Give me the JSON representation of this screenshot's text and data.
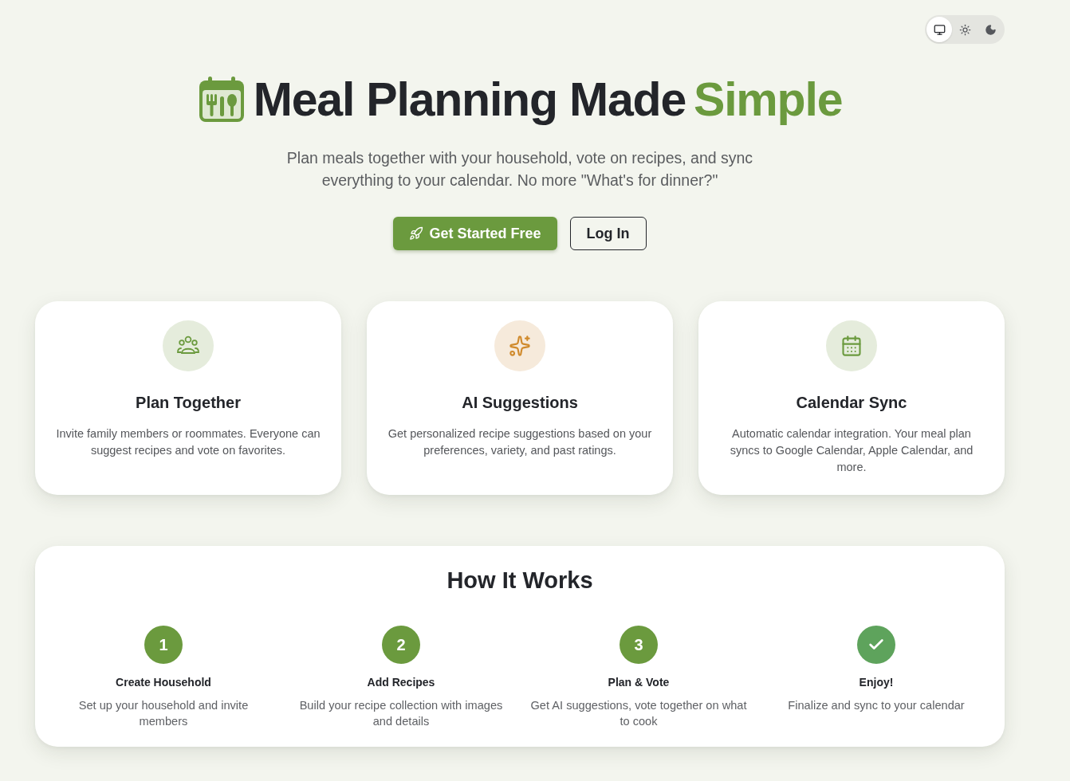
{
  "theme_toggle": [
    {
      "kind": "system",
      "selected": true
    },
    {
      "kind": "light",
      "selected": false
    },
    {
      "kind": "dark",
      "selected": false
    }
  ],
  "hero": {
    "title": "Meal Planning Made",
    "title_highlight": "Simple",
    "subtitle": "Plan meals together with your household, vote on recipes, and sync everything to your calendar. No more \"What's for dinner?\"",
    "buttons": [
      {
        "kind": "primary",
        "label": "Get Started Free"
      },
      {
        "kind": "secondary",
        "label": "Log In"
      }
    ]
  },
  "features": [
    {
      "kind": "people",
      "title": "Plan Together",
      "description": "Invite family members or roommates. Everyone can suggest recipes and vote on favorites."
    },
    {
      "kind": "sparkles",
      "title": "AI Suggestions",
      "description": "Get personalized recipe suggestions based on your preferences, variety, and past ratings."
    },
    {
      "kind": "calendar",
      "title": "Calendar Sync",
      "description": "Automatic calendar integration. Your meal plan syncs to Google Calendar, Apple Calendar, and more."
    }
  ],
  "how_it_works": {
    "title": "How It Works",
    "steps": [
      {
        "kind": "number",
        "number": "1",
        "title": "Create Household",
        "description": "Set up your household and invite members"
      },
      {
        "kind": "number",
        "number": "2",
        "title": "Add Recipes",
        "description": "Build your recipe collection with images and details"
      },
      {
        "kind": "number",
        "number": "3",
        "title": "Plan & Vote",
        "description": "Get AI suggestions, vote together on what to cook"
      },
      {
        "kind": "check",
        "title": "Enjoy!",
        "description": "Finalize and sync to your calendar"
      }
    ]
  }
}
